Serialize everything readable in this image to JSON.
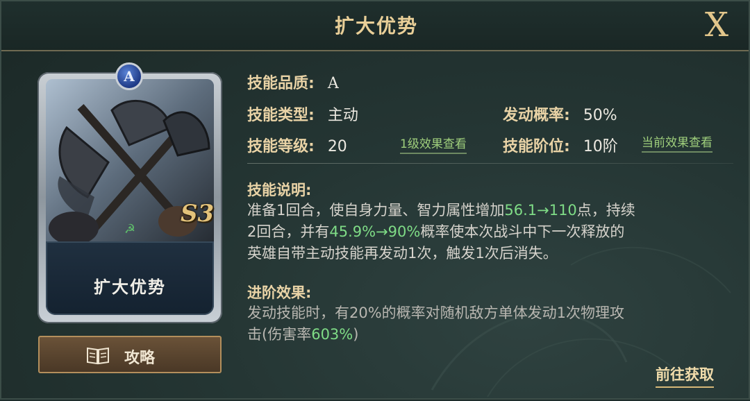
{
  "header": {
    "title": "扩大优势",
    "close_label": "X"
  },
  "card": {
    "name": "扩大优势",
    "grade": "A",
    "season_badge": "S3"
  },
  "guide_button": {
    "label": "攻略",
    "icon": "book-icon"
  },
  "info": {
    "quality": {
      "label": "技能品质:",
      "value": "A"
    },
    "type": {
      "label": "技能类型:",
      "value": "主动"
    },
    "trigger_rate": {
      "label": "发动概率:",
      "value": "50%"
    },
    "level": {
      "label": "技能等级:",
      "value": "20"
    },
    "level_link": "1级效果查看",
    "rank": {
      "label": "技能阶位:",
      "value": "10阶"
    },
    "rank_link": "当前效果查看"
  },
  "description": {
    "title": "技能说明:",
    "line1_a": "准备1回合，使自身力量、智力属性增加",
    "line1_hl": "56.1→110",
    "line1_b": "点，持续",
    "line2_a": "2回合，并有",
    "line2_hl": "45.9%→90%",
    "line2_b": "概率使本次战斗中下一次释放的",
    "line3": "英雄自带主动技能再发动1次，触发1次后消失。"
  },
  "advanced": {
    "title": "进阶效果:",
    "line1": "发动技能时，有20%的概率对随机敌方单体发动1次物理攻",
    "line2_a": "击(伤害率",
    "line2_hl": "603%",
    "line2_b": ")"
  },
  "goto_label": "前往获取",
  "colors": {
    "accent_gold": "#e9cf98",
    "highlight_green": "#7fdc86",
    "link_green": "#9fcf7c"
  }
}
